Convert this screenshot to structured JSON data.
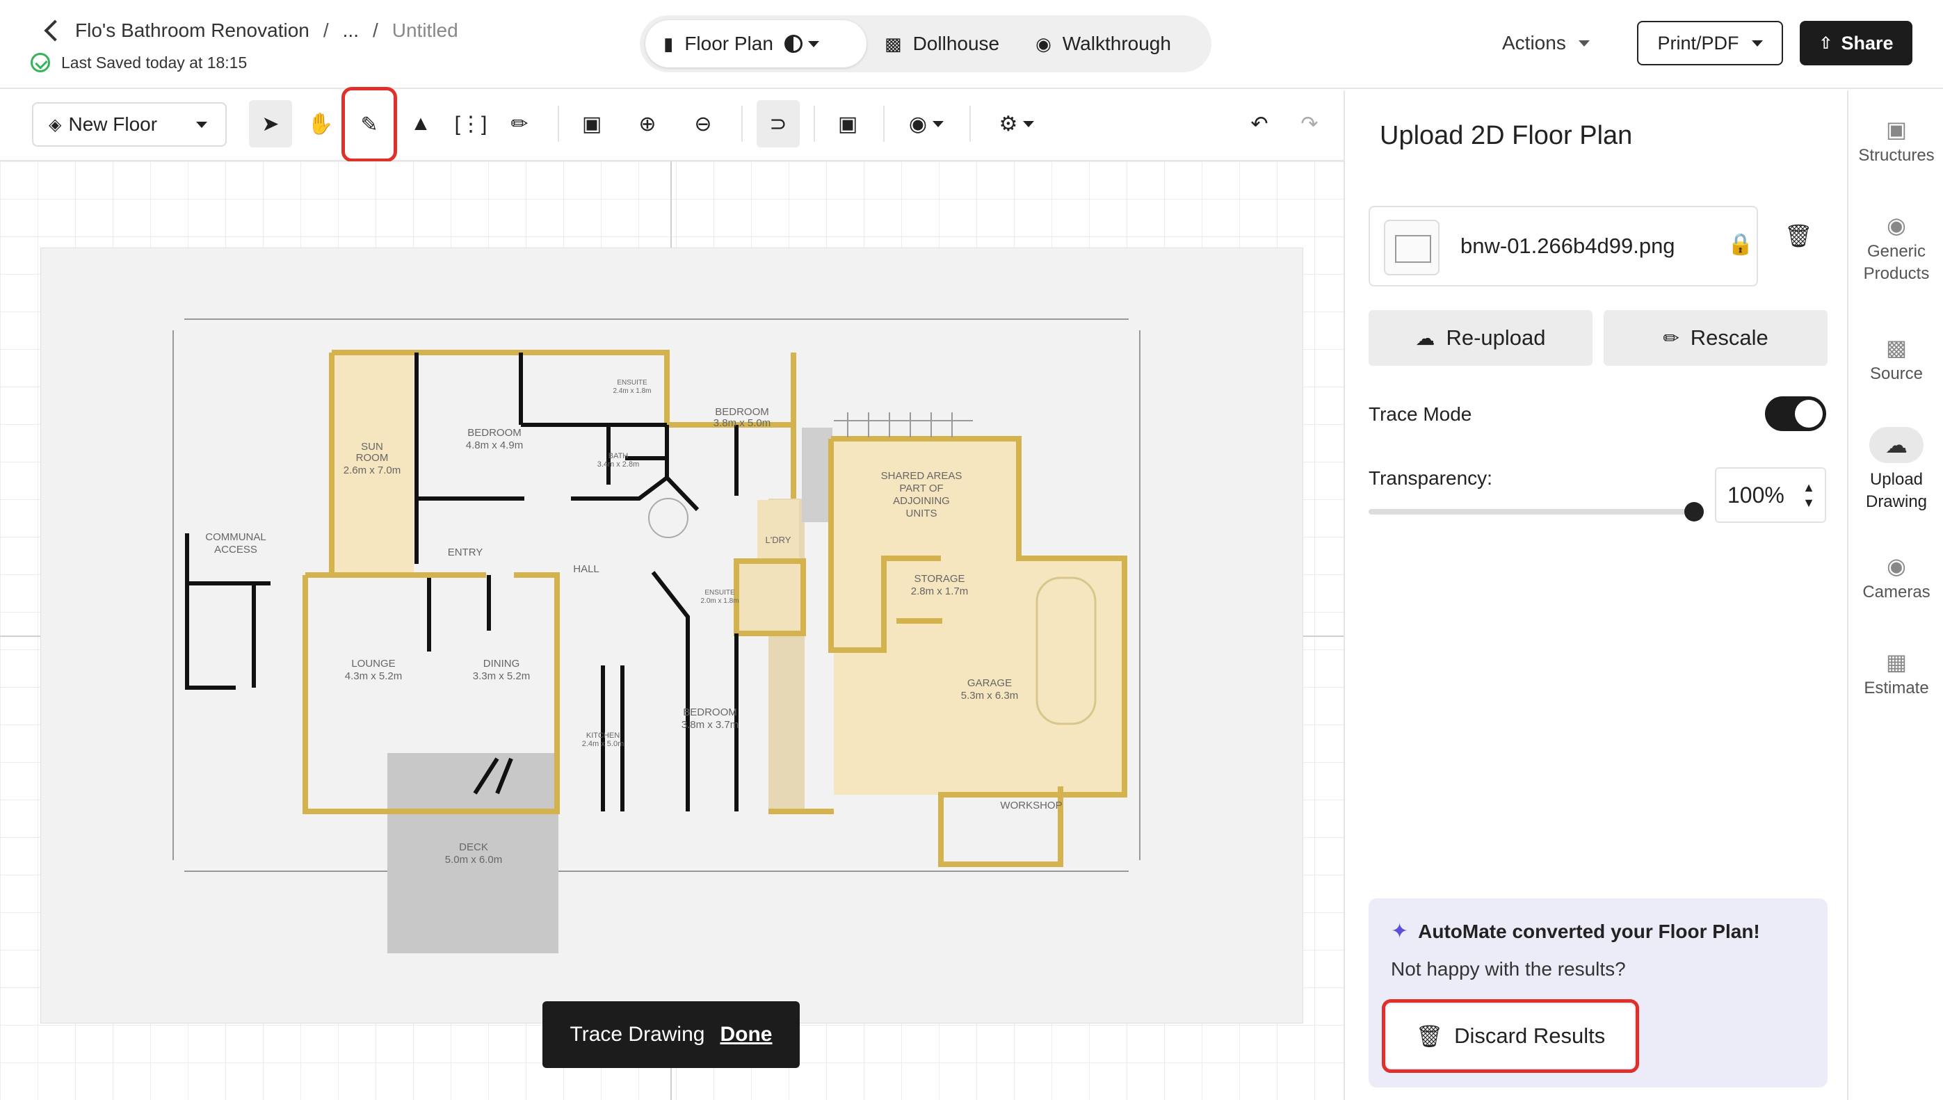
{
  "header": {
    "breadcrumb_project": "Flo's Bathroom Renovation",
    "breadcrumb_sep": "/",
    "breadcrumb_ellipsis": "...",
    "breadcrumb_page": "Untitled",
    "saved_status": "Last Saved today at 18:15",
    "view_tabs": [
      {
        "label": "Floor Plan",
        "icon": "floor-plan-icon",
        "active": true
      },
      {
        "label": "Dollhouse",
        "icon": "cube-icon",
        "active": false
      },
      {
        "label": "Walkthrough",
        "icon": "map-pin-icon",
        "active": false
      }
    ],
    "actions_label": "Actions",
    "print_label": "Print/PDF",
    "share_label": "Share"
  },
  "toolbar": {
    "floor_select": "New Floor",
    "tools": [
      "select",
      "pan",
      "trace-wall",
      "fill",
      "area",
      "ruler",
      "zoom-fit",
      "zoom-in",
      "zoom-out",
      "snap",
      "comment",
      "camera",
      "settings",
      "undo",
      "redo"
    ],
    "highlighted_tool": "trace-wall"
  },
  "canvas": {
    "trace_label": "Trace Drawing",
    "trace_done": "Done",
    "plan": {
      "rooms": [
        {
          "name": "BEDROOM",
          "size": "4.8m x 4.9m"
        },
        {
          "name": "SUN",
          "name2": "ROOM",
          "size": "2.6m x 7.0m"
        },
        {
          "name": "BATH",
          "size": "3.4m x 2.8m"
        },
        {
          "name": "ENSUITE",
          "size": "2.4m x 1.8m"
        },
        {
          "name": "BEDROOM",
          "size": "3.8m x 5.0m"
        },
        {
          "name": "SHARED AREAS",
          "name2": "PART OF",
          "name3": "ADJOINING",
          "name4": "UNITS"
        },
        {
          "name": "COMMUNAL",
          "name2": "ACCESS"
        },
        {
          "name": "ENTRY"
        },
        {
          "name": "HALL"
        },
        {
          "name": "L'DRY"
        },
        {
          "name": "STORAGE",
          "size": "2.8m x 1.7m"
        },
        {
          "name": "ENSUITE",
          "size": "2.0m x 1.8m"
        },
        {
          "name": "LOUNGE",
          "size": "4.3m x 5.2m"
        },
        {
          "name": "DINING",
          "size": "3.3m x 5.2m"
        },
        {
          "name": "KITCHEN",
          "size": "2.4m x 5.0m"
        },
        {
          "name": "BEDROOM",
          "size": "3.8m x 3.7m"
        },
        {
          "name": "GARAGE",
          "size": "5.3m x 6.3m"
        },
        {
          "name": "WORKSHOP"
        },
        {
          "name": "DECK",
          "size": "5.0m x 6.0m"
        }
      ]
    }
  },
  "panel": {
    "title": "Upload 2D Floor Plan",
    "file_name": "bnw-01.266b4d99.png",
    "reupload_label": "Re-upload",
    "rescale_label": "Rescale",
    "trace_mode_label": "Trace Mode",
    "trace_mode_on": true,
    "transparency_label": "Transparency:",
    "transparency_value": "100%",
    "transparency_fraction": 1.0,
    "automate_title": "AutoMate converted your Floor Plan!",
    "automate_sub": "Not happy with the results?",
    "discard_label": "Discard Results"
  },
  "rail": [
    {
      "label": "Structures",
      "icon": "structures-icon"
    },
    {
      "label": "Generic",
      "label2": "Products",
      "icon": "products-icon"
    },
    {
      "label": "Source",
      "icon": "source-icon"
    },
    {
      "label": "Upload",
      "label2": "Drawing",
      "icon": "upload-cloud-icon",
      "active": true
    },
    {
      "label": "Cameras",
      "icon": "camera-icon"
    },
    {
      "label": "Estimate",
      "icon": "calculator-icon"
    }
  ]
}
